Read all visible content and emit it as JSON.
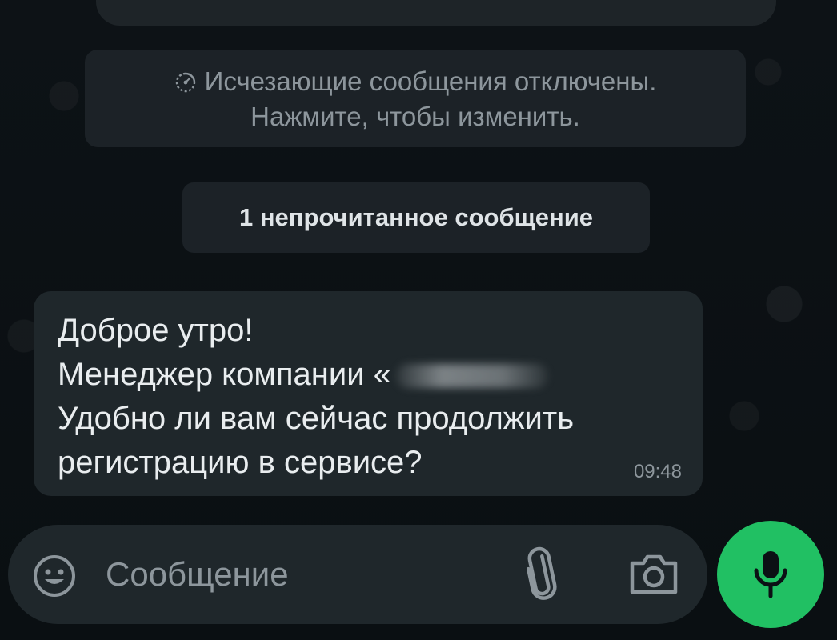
{
  "system_notice": {
    "line1": "Исчезающие сообщения отключены.",
    "line2": "Нажмите, чтобы изменить."
  },
  "unread_divider": {
    "label": "1 непрочитанное сообщение"
  },
  "message": {
    "line1": "Доброе утро!",
    "line2": "Менеджер компании «",
    "line3": "Удобно ли вам сейчас продолжить",
    "line4": "регистрацию в сервисе?",
    "time": "09:48"
  },
  "composer": {
    "placeholder": "Сообщение"
  },
  "icons": {
    "timer": "timer-icon",
    "emoji": "emoji-icon",
    "attach": "paperclip-icon",
    "camera": "camera-icon",
    "mic": "microphone-icon"
  },
  "colors": {
    "background": "#0b1014",
    "bubble": "#1f272b",
    "accent": "#21c063",
    "muted_text": "#8d969c"
  }
}
